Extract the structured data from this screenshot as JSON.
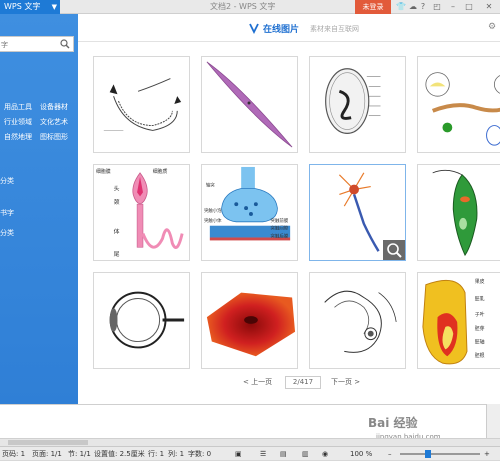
{
  "titlebar": {
    "app_name": "WPS 文字",
    "doc_title": "文档2 - WPS 文字",
    "login": "未登录"
  },
  "leftpanel": {
    "search_placeholder": "字",
    "categories": [
      "用品工具",
      "设备器材",
      "行业领域",
      "文化艺术",
      "自然地理",
      "图标图形"
    ],
    "links": [
      "分类",
      "书字",
      "分类"
    ]
  },
  "dialog": {
    "title": "在线图片",
    "subtitle": "素材来自互联网"
  },
  "pager": {
    "prev": "< 上一页",
    "page": "2/417",
    "next": "下一页 >"
  },
  "statusbar": {
    "page_num": "页码: 1",
    "pages": "页面: 1/1",
    "section": "节: 1/1",
    "setting": "设置值: 2.5厘米",
    "row": "行: 1",
    "col": "列: 1",
    "words": "字数: 0",
    "zoom": "100 %"
  },
  "watermark": {
    "brand": "Bai 经验",
    "url": "jingyan.baidu.com"
  },
  "thumb_labels": {
    "t8": [
      "细胞膜",
      "细胞质",
      "头",
      "颈",
      "体",
      "尾"
    ],
    "t9": [
      "轴突",
      "突触小泡",
      "突触前膜",
      "突触间隙",
      "突触后膜",
      "突触小体"
    ],
    "t12": [
      "果皮",
      "胚乳",
      "子叶",
      "胚芽",
      "胚轴",
      "胚根"
    ]
  }
}
